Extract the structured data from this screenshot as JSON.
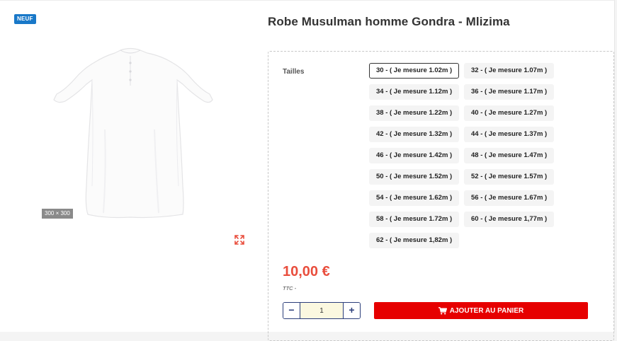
{
  "badge": "NEUF",
  "image": {
    "dimension_label": "300 × 300",
    "expand_icon": "expand-arrows-icon"
  },
  "product": {
    "title": "Robe Musulman homme Gondra - Mlizima"
  },
  "options": {
    "label": "Tailles",
    "sizes": [
      "30 - ( Je mesure 1.02m )",
      "32 - ( Je mesure 1.07m )",
      "34 - ( Je mesure 1.12m )",
      "36 - ( Je mesure 1.17m )",
      "38 - ( Je mesure 1.22m )",
      "40 - ( Je mesure 1.27m )",
      "42 - ( Je mesure 1.32m )",
      "44 - ( Je mesure 1.37m )",
      "46 - ( Je mesure 1.42m )",
      "48 - ( Je mesure 1.47m )",
      "50 - ( Je mesure 1.52m )",
      "52 - ( Je mesure 1.57m )",
      "54 - ( Je mesure 1.62m )",
      "56 - ( Je mesure 1.67m )",
      "58 - ( Je mesure 1.72m )",
      "60 - ( Je mesure 1,77m )",
      "62 - ( Je mesure 1,82m )"
    ],
    "selected_index": 0
  },
  "price": {
    "value": "10,00 €",
    "tax_label": "TTC  -"
  },
  "quantity": {
    "value": "1",
    "minus": "−",
    "plus": "+"
  },
  "cart": {
    "label": "AJOUTER AU PANIER",
    "icon": "shopping-cart-icon"
  },
  "colors": {
    "accent_price": "#e94e3d",
    "cart_button": "#e60000",
    "badge": "#1978c8",
    "qty_border": "#2c3e7a"
  }
}
